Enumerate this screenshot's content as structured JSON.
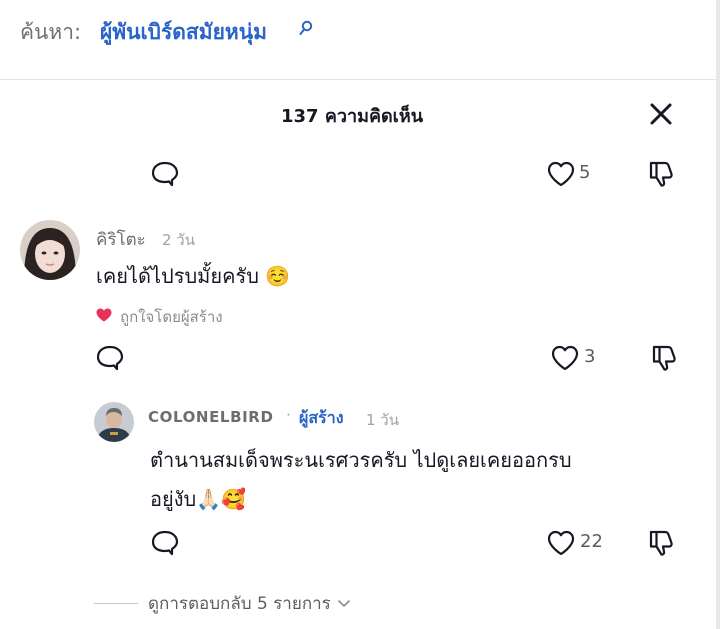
{
  "search": {
    "label": "ค้นหา:",
    "query": "ผู้พันเบิร์ดสมัยหนุ่ม"
  },
  "header": {
    "title": "137 ความคิดเห็น"
  },
  "top_actions": {
    "likes": "5"
  },
  "comment1": {
    "username": "คิริโตะ",
    "time": "2 วัน",
    "text": "เคยได้ไปรบมั้ยครับ ☺️",
    "liked_by": "ถูกใจโดยผู้สร้าง",
    "likes": "3"
  },
  "reply1": {
    "username": "COLONELBIRD",
    "separator": "·",
    "creator_tag": "ผู้สร้าง",
    "time": "1 วัน",
    "text_line1": "ตำนานสมเด็จพระนเรศวรครับ ไปดูเลยเคยออกรบ",
    "text_line2": "อยู่งับ🙏🏻🥰",
    "likes": "22"
  },
  "view_replies": {
    "label": "ดูการตอบกลับ 5 รายการ"
  },
  "colors": {
    "accent": "#2a64c8",
    "heart": "#e8325a",
    "text": "#161823",
    "muted": "#6c6d72"
  },
  "icons": [
    "search-icon",
    "close-icon",
    "reply-icon",
    "heart-icon",
    "dislike-icon",
    "heart-filled-icon",
    "chevron-down-icon"
  ]
}
